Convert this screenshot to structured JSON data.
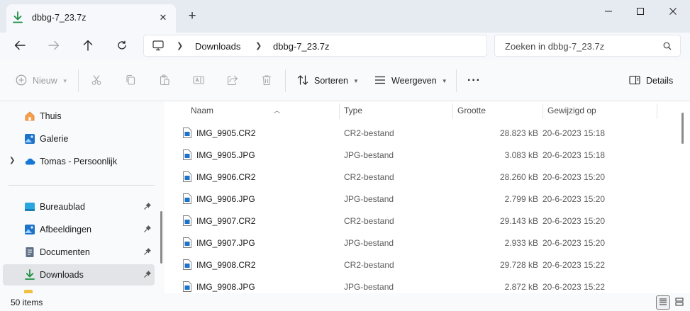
{
  "tab": {
    "title": "dbbg-7_23.7z",
    "close_icon": "close-icon",
    "new_tab_icon": "plus-icon"
  },
  "window": {
    "minimize_icon": "minimize-icon",
    "maximize_icon": "maximize-icon",
    "close_icon": "close-icon"
  },
  "address": {
    "breadcrumb": [
      "Downloads",
      "dbbg-7_23.7z"
    ],
    "search_placeholder": "Zoeken in dbbg-7_23.7z"
  },
  "toolbar": {
    "new_label": "Nieuw",
    "sort_label": "Sorteren",
    "view_label": "Weergeven",
    "more_label": "···",
    "details_label": "Details"
  },
  "sidebar": {
    "items": [
      {
        "label": "Thuis",
        "icon": "home-icon"
      },
      {
        "label": "Galerie",
        "icon": "gallery-icon"
      },
      {
        "label": "Tomas - Persoonlijk",
        "icon": "onedrive-icon"
      },
      {
        "label": "Bureaublad",
        "icon": "desktop-icon"
      },
      {
        "label": "Afbeeldingen",
        "icon": "pictures-icon"
      },
      {
        "label": "Documenten",
        "icon": "documents-icon"
      },
      {
        "label": "Downloads",
        "icon": "download-icon"
      }
    ]
  },
  "columns": {
    "name": "Naam",
    "type": "Type",
    "size": "Grootte",
    "modified": "Gewijzigd op"
  },
  "files": [
    {
      "name": "IMG_9905.CR2",
      "type": "CR2-bestand",
      "size": "28.823 kB",
      "modified": "20-6-2023 15:18"
    },
    {
      "name": "IMG_9905.JPG",
      "type": "JPG-bestand",
      "size": "3.083 kB",
      "modified": "20-6-2023 15:18"
    },
    {
      "name": "IMG_9906.CR2",
      "type": "CR2-bestand",
      "size": "28.260 kB",
      "modified": "20-6-2023 15:20"
    },
    {
      "name": "IMG_9906.JPG",
      "type": "JPG-bestand",
      "size": "2.799 kB",
      "modified": "20-6-2023 15:20"
    },
    {
      "name": "IMG_9907.CR2",
      "type": "CR2-bestand",
      "size": "29.143 kB",
      "modified": "20-6-2023 15:20"
    },
    {
      "name": "IMG_9907.JPG",
      "type": "JPG-bestand",
      "size": "2.933 kB",
      "modified": "20-6-2023 15:20"
    },
    {
      "name": "IMG_9908.CR2",
      "type": "CR2-bestand",
      "size": "29.728 kB",
      "modified": "20-6-2023 15:22"
    },
    {
      "name": "IMG_9908.JPG",
      "type": "JPG-bestand",
      "size": "2.872 kB",
      "modified": "20-6-2023 15:22"
    }
  ],
  "status": {
    "item_count": "50 items"
  },
  "colors": {
    "accent": "#1a7f37",
    "folder_blue": "#1e73c8",
    "selected_bg": "#e2e4e8"
  }
}
